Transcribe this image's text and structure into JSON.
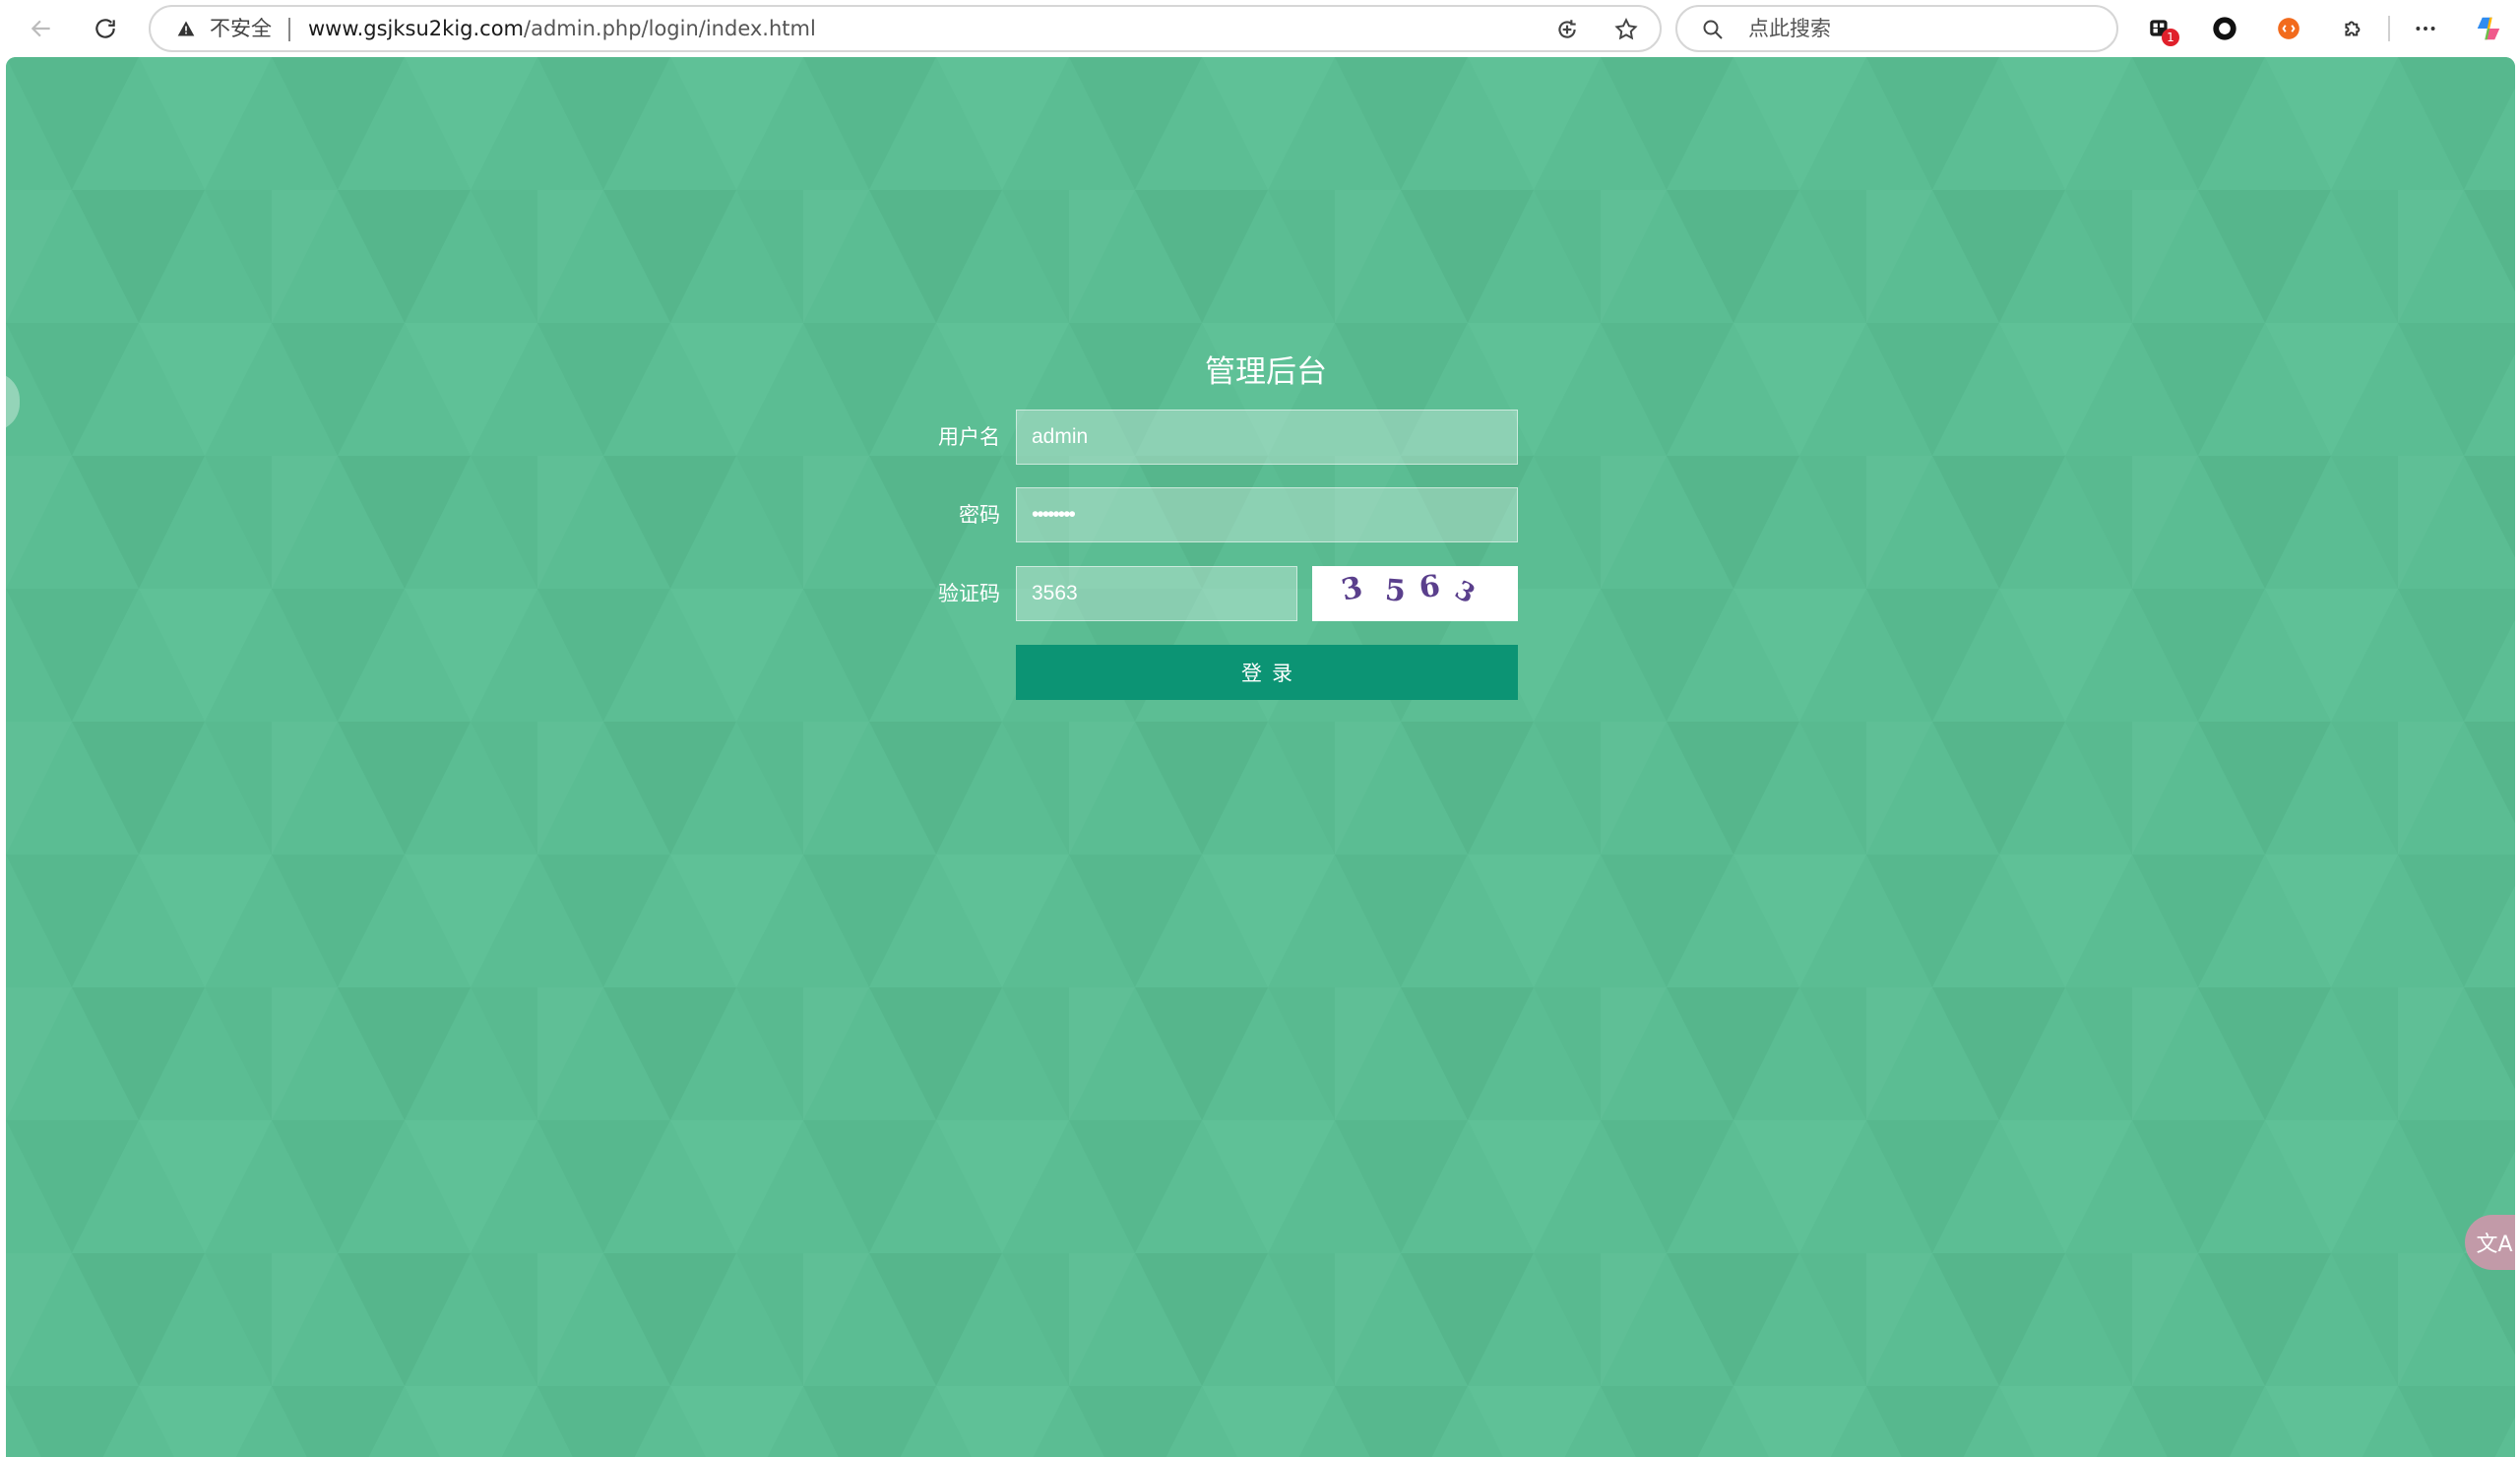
{
  "browser": {
    "security_label": "不安全",
    "url_host": "www.gsjksu2kig.com",
    "url_path": "/admin.php/login/index.html",
    "search_placeholder": "点此搜索",
    "extension_badge_count": "1",
    "icons": [
      "back-icon",
      "reload-icon",
      "warning-icon",
      "refresh-page-icon",
      "star-icon",
      "search-icon",
      "extension-icon",
      "record-icon",
      "orange-extension-icon",
      "puzzle-icon",
      "more-icon",
      "copilot-icon"
    ]
  },
  "login": {
    "title": "管理后台",
    "username_label": "用户名",
    "username_value": "admin",
    "password_label": "密码",
    "password_value": "••••••••",
    "captcha_label": "验证码",
    "captcha_value": "3563",
    "captcha_chars": [
      "3",
      "5",
      "6",
      "3"
    ],
    "submit_label": "登录"
  },
  "floating": {
    "translate_label": "文A"
  },
  "colors": {
    "background": "#5bbd93",
    "button": "#0c9474",
    "captcha_text": "#5a3f8c"
  }
}
